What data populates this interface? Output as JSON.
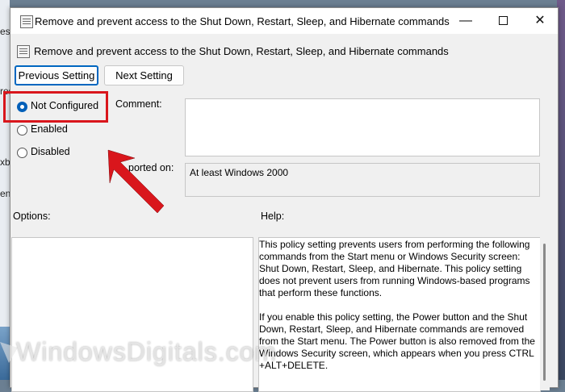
{
  "background": {
    "left_fragments": [
      "es",
      "res",
      "xb",
      "en"
    ]
  },
  "window": {
    "title": "Remove and prevent access to the Shut Down, Restart, Sleep, and Hibernate commands",
    "minimize_glyph": "—",
    "close_glyph": "✕"
  },
  "policy": {
    "name": "Remove and prevent access to the Shut Down, Restart, Sleep, and Hibernate commands"
  },
  "nav": {
    "previous_label": "Previous Setting",
    "next_label": "Next Setting"
  },
  "state": {
    "options": [
      {
        "label": "Not Configured",
        "selected": true
      },
      {
        "label": "Enabled",
        "selected": false
      },
      {
        "label": "Disabled",
        "selected": false
      }
    ]
  },
  "comment": {
    "label": "Comment:",
    "value": ""
  },
  "supported": {
    "label": "Supported on:",
    "label_visible": "ported on:",
    "value": "At least Windows 2000"
  },
  "options_label": "Options:",
  "help": {
    "label": "Help:",
    "paragraphs": [
      "This policy setting prevents users from performing the following commands from the Start menu or Windows Security screen: Shut Down, Restart, Sleep, and Hibernate. This policy setting does not prevent users from running Windows-based programs that perform these functions.",
      "If you enable this policy setting, the Power button and the Shut Down, Restart, Sleep, and Hibernate commands are removed from the Start menu. The Power button is also removed from the Windows Security screen, which appears when you press CTRL +ALT+DELETE."
    ]
  },
  "annotation": {
    "highlight_color": "#d9161c"
  },
  "watermark": {
    "text": "WindowsDigitals.com"
  },
  "colors": {
    "accent": "#005fb8",
    "focus_border": "#0067c0"
  }
}
